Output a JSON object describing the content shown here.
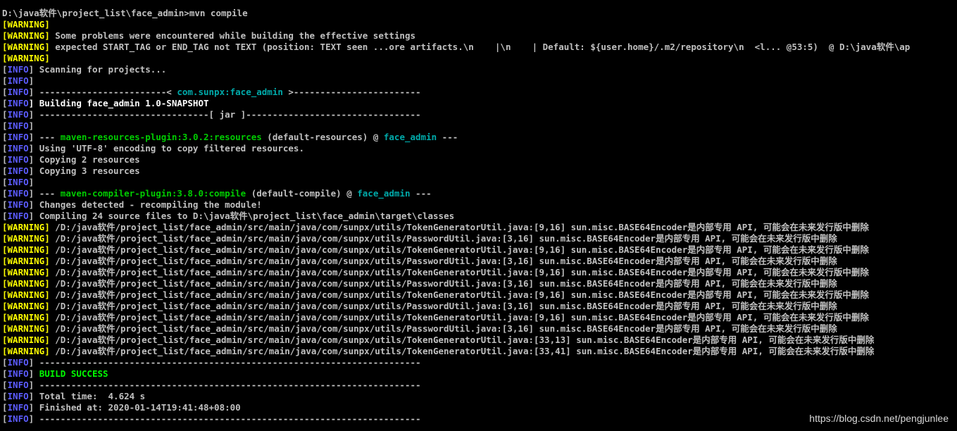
{
  "terminal": {
    "lines": [
      {
        "segments": [
          {
            "text": "D:\\java软件\\project_list\\face_admin>mvn compile",
            "cls": "plain"
          }
        ]
      },
      {
        "segments": [
          {
            "text": "[WARNING]",
            "cls": "warn"
          }
        ]
      },
      {
        "segments": [
          {
            "text": "[WARNING]",
            "cls": "warn"
          },
          {
            "text": " Some problems were encountered while building the effective settings",
            "cls": "plain"
          }
        ]
      },
      {
        "segments": [
          {
            "text": "[WARNING]",
            "cls": "warn"
          },
          {
            "text": " expected START_TAG or END_TAG not TEXT (position: TEXT seen ...ore artifacts.\\n    |\\n    | Default: ${user.home}/.m2/repository\\n  <l... @53:5)  @ D:\\java软件\\ap",
            "cls": "plain"
          }
        ]
      },
      {
        "segments": [
          {
            "text": "[WARNING]",
            "cls": "warn"
          }
        ]
      },
      {
        "segments": [
          {
            "text": "[",
            "cls": "plain"
          },
          {
            "text": "INFO",
            "cls": "info"
          },
          {
            "text": "] Scanning for projects...",
            "cls": "plain"
          }
        ]
      },
      {
        "segments": [
          {
            "text": "[",
            "cls": "plain"
          },
          {
            "text": "INFO",
            "cls": "info"
          },
          {
            "text": "]",
            "cls": "plain"
          }
        ]
      },
      {
        "segments": [
          {
            "text": "[",
            "cls": "plain"
          },
          {
            "text": "INFO",
            "cls": "info"
          },
          {
            "text": "] ------------------------< ",
            "cls": "plain"
          },
          {
            "text": "com.sunpx:face_admin",
            "cls": "cyan"
          },
          {
            "text": " >------------------------",
            "cls": "plain"
          }
        ]
      },
      {
        "segments": [
          {
            "text": "[",
            "cls": "plain"
          },
          {
            "text": "INFO",
            "cls": "info"
          },
          {
            "text": "] Building face_admin 1.0-SNAPSHOT",
            "cls": "white"
          }
        ]
      },
      {
        "segments": [
          {
            "text": "[",
            "cls": "plain"
          },
          {
            "text": "INFO",
            "cls": "info"
          },
          {
            "text": "] --------------------------------[ jar ]---------------------------------",
            "cls": "plain"
          }
        ]
      },
      {
        "segments": [
          {
            "text": "[",
            "cls": "plain"
          },
          {
            "text": "INFO",
            "cls": "info"
          },
          {
            "text": "]",
            "cls": "plain"
          }
        ]
      },
      {
        "segments": [
          {
            "text": "[",
            "cls": "plain"
          },
          {
            "text": "INFO",
            "cls": "info"
          },
          {
            "text": "] --- ",
            "cls": "plain"
          },
          {
            "text": "maven-resources-plugin:3.0.2:resources",
            "cls": "green"
          },
          {
            "text": " (default-resources) @ ",
            "cls": "plain"
          },
          {
            "text": "face_admin",
            "cls": "cyan"
          },
          {
            "text": " ---",
            "cls": "plain"
          }
        ]
      },
      {
        "segments": [
          {
            "text": "[",
            "cls": "plain"
          },
          {
            "text": "INFO",
            "cls": "info"
          },
          {
            "text": "] Using 'UTF-8' encoding to copy filtered resources.",
            "cls": "plain"
          }
        ]
      },
      {
        "segments": [
          {
            "text": "[",
            "cls": "plain"
          },
          {
            "text": "INFO",
            "cls": "info"
          },
          {
            "text": "] Copying 2 resources",
            "cls": "plain"
          }
        ]
      },
      {
        "segments": [
          {
            "text": "[",
            "cls": "plain"
          },
          {
            "text": "INFO",
            "cls": "info"
          },
          {
            "text": "] Copying 3 resources",
            "cls": "plain"
          }
        ]
      },
      {
        "segments": [
          {
            "text": "[",
            "cls": "plain"
          },
          {
            "text": "INFO",
            "cls": "info"
          },
          {
            "text": "]",
            "cls": "plain"
          }
        ]
      },
      {
        "segments": [
          {
            "text": "[",
            "cls": "plain"
          },
          {
            "text": "INFO",
            "cls": "info"
          },
          {
            "text": "] --- ",
            "cls": "plain"
          },
          {
            "text": "maven-compiler-plugin:3.8.0:compile",
            "cls": "green"
          },
          {
            "text": " (default-compile) @ ",
            "cls": "plain"
          },
          {
            "text": "face_admin",
            "cls": "cyan"
          },
          {
            "text": " ---",
            "cls": "plain"
          }
        ]
      },
      {
        "segments": [
          {
            "text": "[",
            "cls": "plain"
          },
          {
            "text": "INFO",
            "cls": "info"
          },
          {
            "text": "] Changes detected - recompiling the module!",
            "cls": "plain"
          }
        ]
      },
      {
        "segments": [
          {
            "text": "[",
            "cls": "plain"
          },
          {
            "text": "INFO",
            "cls": "info"
          },
          {
            "text": "] Compiling 24 source files to D:\\java软件\\project_list\\face_admin\\target\\classes",
            "cls": "plain"
          }
        ]
      },
      {
        "segments": [
          {
            "text": "[WARNING]",
            "cls": "warn"
          },
          {
            "text": " /D:/java软件/project_list/face_admin/src/main/java/com/sunpx/utils/TokenGeneratorUtil.java:[9,16] sun.misc.BASE64Encoder是内部专用 API, 可能会在未来发行版中删除",
            "cls": "plain"
          }
        ]
      },
      {
        "segments": [
          {
            "text": "[WARNING]",
            "cls": "warn"
          },
          {
            "text": " /D:/java软件/project_list/face_admin/src/main/java/com/sunpx/utils/PasswordUtil.java:[3,16] sun.misc.BASE64Encoder是内部专用 API, 可能会在未来发行版中删除",
            "cls": "plain"
          }
        ]
      },
      {
        "segments": [
          {
            "text": "[WARNING]",
            "cls": "warn"
          },
          {
            "text": " /D:/java软件/project_list/face_admin/src/main/java/com/sunpx/utils/TokenGeneratorUtil.java:[9,16] sun.misc.BASE64Encoder是内部专用 API, 可能会在未来发行版中删除",
            "cls": "plain"
          }
        ]
      },
      {
        "segments": [
          {
            "text": "[WARNING]",
            "cls": "warn"
          },
          {
            "text": " /D:/java软件/project_list/face_admin/src/main/java/com/sunpx/utils/PasswordUtil.java:[3,16] sun.misc.BASE64Encoder是内部专用 API, 可能会在未来发行版中删除",
            "cls": "plain"
          }
        ]
      },
      {
        "segments": [
          {
            "text": "[WARNING]",
            "cls": "warn"
          },
          {
            "text": " /D:/java软件/project_list/face_admin/src/main/java/com/sunpx/utils/TokenGeneratorUtil.java:[9,16] sun.misc.BASE64Encoder是内部专用 API, 可能会在未来发行版中删除",
            "cls": "plain"
          }
        ]
      },
      {
        "segments": [
          {
            "text": "[WARNING]",
            "cls": "warn"
          },
          {
            "text": " /D:/java软件/project_list/face_admin/src/main/java/com/sunpx/utils/PasswordUtil.java:[3,16] sun.misc.BASE64Encoder是内部专用 API, 可能会在未来发行版中删除",
            "cls": "plain"
          }
        ]
      },
      {
        "segments": [
          {
            "text": "[WARNING]",
            "cls": "warn"
          },
          {
            "text": " /D:/java软件/project_list/face_admin/src/main/java/com/sunpx/utils/TokenGeneratorUtil.java:[9,16] sun.misc.BASE64Encoder是内部专用 API, 可能会在未来发行版中删除",
            "cls": "plain"
          }
        ]
      },
      {
        "segments": [
          {
            "text": "[WARNING]",
            "cls": "warn"
          },
          {
            "text": " /D:/java软件/project_list/face_admin/src/main/java/com/sunpx/utils/PasswordUtil.java:[3,16] sun.misc.BASE64Encoder是内部专用 API, 可能会在未来发行版中删除",
            "cls": "plain"
          }
        ]
      },
      {
        "segments": [
          {
            "text": "[WARNING]",
            "cls": "warn"
          },
          {
            "text": " /D:/java软件/project_list/face_admin/src/main/java/com/sunpx/utils/TokenGeneratorUtil.java:[9,16] sun.misc.BASE64Encoder是内部专用 API, 可能会在未来发行版中删除",
            "cls": "plain"
          }
        ]
      },
      {
        "segments": [
          {
            "text": "[WARNING]",
            "cls": "warn"
          },
          {
            "text": " /D:/java软件/project_list/face_admin/src/main/java/com/sunpx/utils/PasswordUtil.java:[3,16] sun.misc.BASE64Encoder是内部专用 API, 可能会在未来发行版中删除",
            "cls": "plain"
          }
        ]
      },
      {
        "segments": [
          {
            "text": "[WARNING]",
            "cls": "warn"
          },
          {
            "text": " /D:/java软件/project_list/face_admin/src/main/java/com/sunpx/utils/TokenGeneratorUtil.java:[33,13] sun.misc.BASE64Encoder是内部专用 API, 可能会在未来发行版中删除",
            "cls": "plain"
          }
        ]
      },
      {
        "segments": [
          {
            "text": "[WARNING]",
            "cls": "warn"
          },
          {
            "text": " /D:/java软件/project_list/face_admin/src/main/java/com/sunpx/utils/TokenGeneratorUtil.java:[33,41] sun.misc.BASE64Encoder是内部专用 API, 可能会在未来发行版中删除",
            "cls": "plain"
          }
        ]
      },
      {
        "segments": [
          {
            "text": "[",
            "cls": "plain"
          },
          {
            "text": "INFO",
            "cls": "info"
          },
          {
            "text": "] ------------------------------------------------------------------------",
            "cls": "plain"
          }
        ]
      },
      {
        "segments": [
          {
            "text": "[",
            "cls": "plain"
          },
          {
            "text": "INFO",
            "cls": "info"
          },
          {
            "text": "] ",
            "cls": "plain"
          },
          {
            "text": "BUILD SUCCESS",
            "cls": "greenbright"
          }
        ]
      },
      {
        "segments": [
          {
            "text": "[",
            "cls": "plain"
          },
          {
            "text": "INFO",
            "cls": "info"
          },
          {
            "text": "] ------------------------------------------------------------------------",
            "cls": "plain"
          }
        ]
      },
      {
        "segments": [
          {
            "text": "[",
            "cls": "plain"
          },
          {
            "text": "INFO",
            "cls": "info"
          },
          {
            "text": "] Total time:  4.624 s",
            "cls": "plain"
          }
        ]
      },
      {
        "segments": [
          {
            "text": "[",
            "cls": "plain"
          },
          {
            "text": "INFO",
            "cls": "info"
          },
          {
            "text": "] Finished at: 2020-01-14T19:41:48+08:00",
            "cls": "plain"
          }
        ]
      },
      {
        "segments": [
          {
            "text": "[",
            "cls": "plain"
          },
          {
            "text": "INFO",
            "cls": "info"
          },
          {
            "text": "] ------------------------------------------------------------------------",
            "cls": "plain"
          }
        ]
      }
    ]
  },
  "watermark": {
    "text": "https://blog.csdn.net/pengjunlee"
  }
}
